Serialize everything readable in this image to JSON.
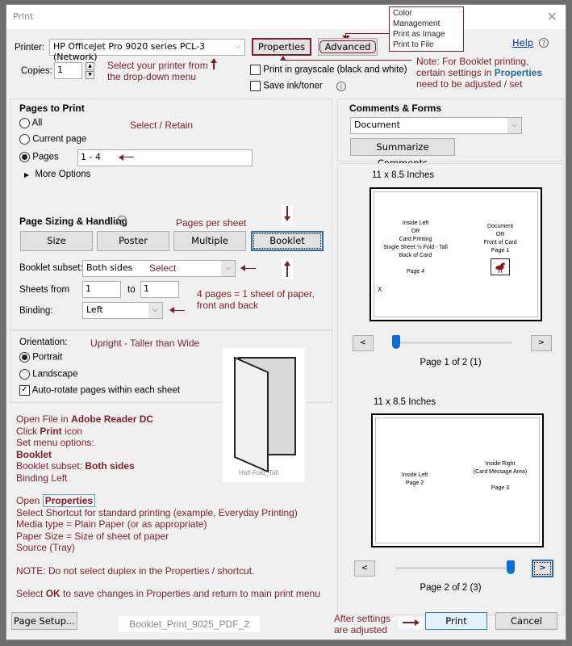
{
  "window": {
    "title": "Print",
    "close_glyph": "✕"
  },
  "printer": {
    "label": "Printer:",
    "value": "HP OfficeJet Pro 9020 series PCL-3 (Network)",
    "properties_label": "Properties",
    "advanced_label": "Advanced",
    "help_label": "Help"
  },
  "copies": {
    "label": "Copies:",
    "value": "1"
  },
  "options": {
    "grayscale_label": "Print in grayscale (black and white)",
    "grayscale_checked": false,
    "save_ink_label": "Save ink/toner",
    "save_ink_checked": false
  },
  "advanced_callout": [
    "Color Management",
    "Print as Image",
    "Print to File"
  ],
  "annotations": {
    "select_printer": [
      "Select your printer from",
      "the drop-down menu"
    ],
    "note_line1": "Note:  For Booklet printing,",
    "note_line2a": "certain settings in ",
    "note_line2b": "Properties",
    "note_line3": "need to be adjusted / set",
    "select_retain": "Select / Retain",
    "pages_per_sheet": "Pages per sheet",
    "select": "Select",
    "four_pages": [
      "4 pages = 1 sheet of paper,",
      "front and back"
    ],
    "upright": "Upright - Taller than Wide",
    "after_settings": [
      "After settings",
      "are adjusted"
    ],
    "file_label": "Booklet_Print_9025_PDF_2",
    "fold_image_caption": "Half-Fold_Tall"
  },
  "instructions": {
    "line1a": "Open File in ",
    "line1b": "Adobe Reader DC",
    "line2a": "Click ",
    "line2b": "Print",
    "line2c": " icon",
    "line3": "Set menu options:",
    "line4": "Booklet",
    "line5a": "Booklet subset:  ",
    "line5b": "Both sides",
    "line6": "Binding Left",
    "line7a": "Open ",
    "line7b": "Properties",
    "line8": "Select Shortcut for standard printing (example, Everyday Printing)",
    "line9": "Media type = Plain Paper (or as appropriate)",
    "line10": "Paper Size = Size of sheet of paper",
    "line11": "Source (Tray)",
    "line12": "NOTE:  Do not select duplex in the Properties / shortcut.",
    "line13a": "Select ",
    "line13b": "OK",
    "line13c": " to save changes in Properties and return to main print menu"
  },
  "pages_to_print": {
    "heading": "Pages to Print",
    "all_label": "All",
    "current_label": "Current page",
    "pages_label": "Pages",
    "pages_value": "1 - 4",
    "selected": "pages",
    "more_options_label": "More Options"
  },
  "page_sizing": {
    "heading": "Page Sizing & Handling",
    "buttons": [
      "Size",
      "Poster",
      "Multiple",
      "Booklet"
    ],
    "active": "Booklet",
    "booklet_subset_label": "Booklet subset:",
    "booklet_subset_value": "Both sides",
    "sheets_from_label": "Sheets from",
    "sheets_from_value": "1",
    "to_label": "to",
    "sheets_to_value": "1",
    "binding_label": "Binding:",
    "binding_value": "Left"
  },
  "orientation": {
    "label": "Orientation:",
    "portrait_label": "Portrait",
    "landscape_label": "Landscape",
    "selected": "portrait",
    "autorotate_label": "Auto-rotate pages within each sheet",
    "autorotate_checked": true
  },
  "comments_forms": {
    "heading": "Comments & Forms",
    "value": "Document",
    "summarize_label": "Summarize Comments"
  },
  "preview1": {
    "size_label": "11 x 8.5 Inches",
    "left_text": [
      "Inside Left",
      "OR",
      "Card Printing",
      "Single Sheet ½ Fold - Tall",
      "Back of Card",
      "",
      "Page 4"
    ],
    "right_text": [
      "Document",
      "OR",
      "Front of Card",
      "Page 1"
    ],
    "mark": "X",
    "page_label": "Page 1 of 2 (1)",
    "slider_position": 0.0,
    "prev_label": "<",
    "next_label": ">"
  },
  "preview2": {
    "size_label": "11 x 8.5 Inches",
    "left_text": [
      "Inside Left",
      "Page 2"
    ],
    "right_text": [
      "Inside Right",
      "(Card Message Area)",
      "",
      "Page 3"
    ],
    "page_label": "Page 2 of 2 (3)",
    "slider_position": 1.0,
    "prev_label": "<",
    "next_label": ">"
  },
  "footer": {
    "page_setup_label": "Page Setup...",
    "print_label": "Print",
    "cancel_label": "Cancel"
  }
}
